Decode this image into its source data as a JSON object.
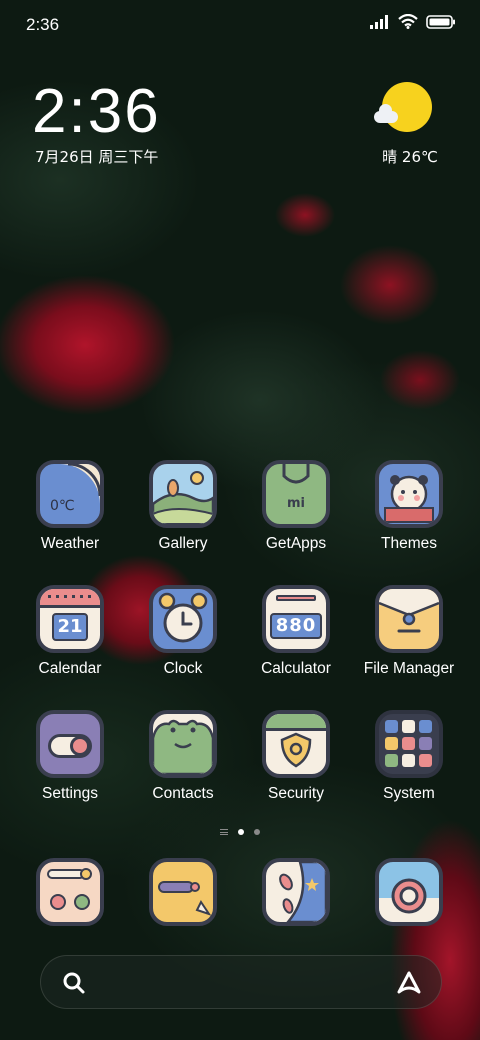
{
  "status_bar": {
    "time": "2:36"
  },
  "clock_widget": {
    "time": "2:36",
    "date": "7月26日 周三下午"
  },
  "weather_widget": {
    "text": "晴 26℃"
  },
  "apps": [
    {
      "label": "Weather",
      "icon": "weather-icon",
      "inner_text": "0℃"
    },
    {
      "label": "Gallery",
      "icon": "gallery-icon"
    },
    {
      "label": "GetApps",
      "icon": "getapps-icon",
      "inner_text": "mi"
    },
    {
      "label": "Themes",
      "icon": "themes-icon"
    },
    {
      "label": "Calendar",
      "icon": "calendar-icon",
      "inner_text": "21"
    },
    {
      "label": "Clock",
      "icon": "clock-icon"
    },
    {
      "label": "Calculator",
      "icon": "calculator-icon",
      "inner_text": "880"
    },
    {
      "label": "File Manager",
      "icon": "file-manager-icon"
    },
    {
      "label": "Settings",
      "icon": "settings-icon"
    },
    {
      "label": "Contacts",
      "icon": "contacts-icon"
    },
    {
      "label": "Security",
      "icon": "security-icon"
    },
    {
      "label": "System",
      "icon": "system-folder-icon"
    }
  ],
  "dock": [
    {
      "icon": "phone-dialer-icon"
    },
    {
      "icon": "messages-icon"
    },
    {
      "icon": "browser-icon"
    },
    {
      "icon": "camera-icon"
    }
  ],
  "page_indicator": {
    "pages": 2,
    "current": 1
  },
  "colors": {
    "icon_border": "#3a3e4e",
    "sun": "#f7d21e"
  }
}
